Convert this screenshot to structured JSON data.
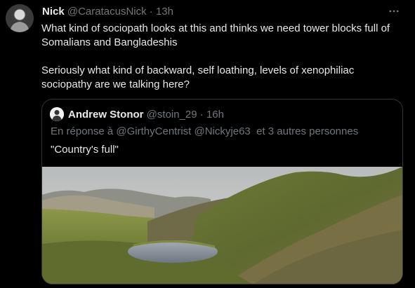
{
  "tweet": {
    "author_name": "Nick",
    "author_handle": "@CaratacusNick",
    "separator": "·",
    "timestamp": "13h",
    "paragraphs": [
      "What kind of sociopath looks at this and thinks we need tower blocks full of Somalians and Bangladeshis",
      "Seriously what kind of backward, self loathing, levels of xenophiliac sociopathy are we talking here?"
    ],
    "more_icon": "more-horizontal-icon"
  },
  "quote": {
    "author_name": "Andrew Stonor",
    "author_handle": "@stoin_29",
    "separator": "·",
    "timestamp": "16h",
    "reply_prefix": "En réponse à",
    "mentions": [
      "@GirthyCentrist",
      "@Nickyje63"
    ],
    "reply_suffix": "et 3 autres personnes",
    "text": "\"Country's full\"",
    "image": "photo of a highland valley with a small loch and green hills"
  },
  "colors": {
    "background": "#000000",
    "text_primary": "#e7e9ea",
    "text_secondary": "#71767b",
    "border": "#2f3336"
  }
}
